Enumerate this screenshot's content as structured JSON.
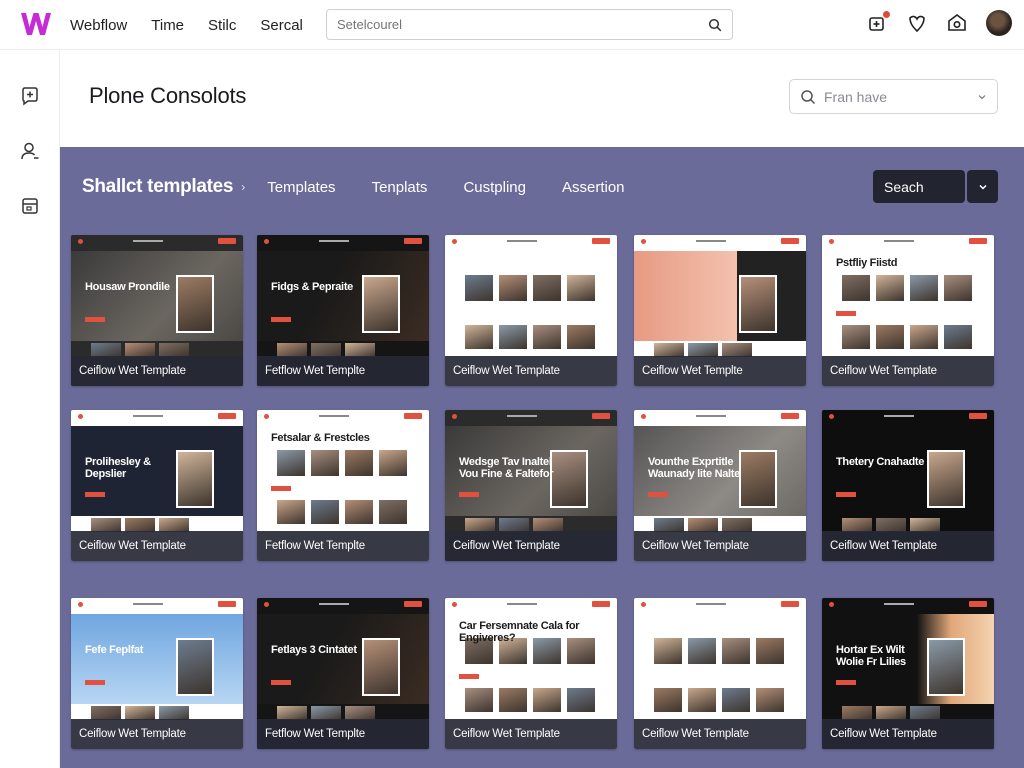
{
  "app": {
    "logo_letter": "W",
    "brand_color": "#c72bd8",
    "nav": [
      "Webflow",
      "Time",
      "Stilc",
      "Sercal"
    ],
    "search_placeholder": "Setelcourel"
  },
  "page": {
    "title": "Plone Consolots",
    "filter_placeholder": "Fran have"
  },
  "panel": {
    "title": "Shallct templates",
    "tabs": [
      "Templates",
      "Tenplats",
      "Custpling",
      "Assertion"
    ],
    "search_button": "Seach",
    "background": "#6a6b99"
  },
  "cards": [
    {
      "caption": "Ceiflow Wet Template",
      "hero_title": "Housaw Prondile",
      "theme": "dark-photo"
    },
    {
      "caption": "Fetflow Wet Templte",
      "hero_title": "Fidgs & Pepraite",
      "theme": "dark"
    },
    {
      "caption": "Ceiflow Wet Template",
      "hero_title": "",
      "theme": "light-grid"
    },
    {
      "caption": "Ceiflow Wet Templte",
      "hero_title": "",
      "theme": "peach"
    },
    {
      "caption": "Ceiflow Wet Template",
      "hero_title": "Pstfliy Fiistd",
      "theme": "light-grid2"
    },
    {
      "caption": "Ceiflow Wet Template",
      "hero_title": "Prolihesley & Depslier",
      "theme": "navy"
    },
    {
      "caption": "Fetflow Wet Templte",
      "hero_title": "Fetsalar & Frestcles",
      "theme": "light-people"
    },
    {
      "caption": "Ceiflow Wet Template",
      "hero_title": "Wedsge Tav Inaltel Vou Fine & Faltefor",
      "theme": "dark-photo"
    },
    {
      "caption": "Ceiflow Wet Template",
      "hero_title": "Vounthe Exprtitle Waunady lite Nalte",
      "theme": "grey-photo"
    },
    {
      "caption": "Ceiflow Wet Template",
      "hero_title": "Thetery Cnahadte",
      "theme": "black"
    },
    {
      "caption": "Ceiflow Wet Template",
      "hero_title": "Fefe Feplfat",
      "theme": "sky"
    },
    {
      "caption": "Fetflow Wet Templte",
      "hero_title": "Fetlays 3 Cintatet",
      "theme": "dark"
    },
    {
      "caption": "Ceiflow Wet Template",
      "hero_title": "Car Fersemnate Cala for Engiveres?",
      "theme": "light-person"
    },
    {
      "caption": "Ceiflow Wet Template",
      "hero_title": "",
      "theme": "light-grid3"
    },
    {
      "caption": "Ceiflow Wet Template",
      "hero_title": "Hortar Ex Wilt Wolie Fr Lilies",
      "theme": "black-sunset"
    }
  ]
}
